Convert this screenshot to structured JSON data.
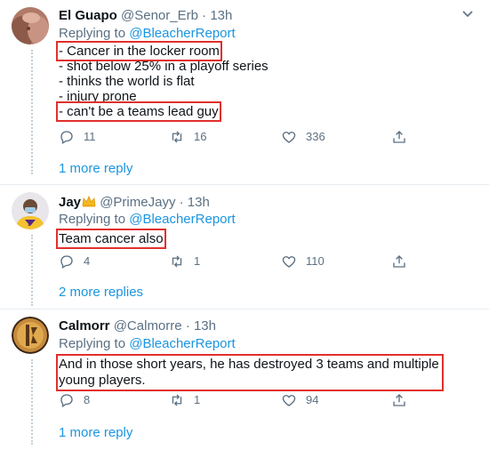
{
  "tweets": [
    {
      "name": "El Guapo",
      "handle": "@Senor_Erb",
      "dot": "·",
      "time": "13h",
      "replying_prefix": "Replying to ",
      "replying_mention": "@BleacherReport",
      "lines": [
        "- Cancer in the locker room",
        "- shot below 25% in a playoff series",
        "- thinks the world is flat",
        "- injury prone",
        "- can't be a teams lead guy"
      ],
      "replies": "11",
      "retweets": "16",
      "likes": "336",
      "more_replies": "1 more reply"
    },
    {
      "name": "Jay",
      "name_emoji": "crown-icon",
      "handle": "@PrimeJayy",
      "dot": "·",
      "time": "13h",
      "replying_prefix": "Replying to ",
      "replying_mention": "@BleacherReport",
      "lines": [
        "Team cancer also"
      ],
      "replies": "4",
      "retweets": "1",
      "likes": "110",
      "more_replies": "2 more replies"
    },
    {
      "name": "Calmorr",
      "handle": "@Calmorre",
      "dot": "·",
      "time": "13h",
      "replying_prefix": "Replying to ",
      "replying_mention": "@BleacherReport",
      "lines": [
        "And in those short years, he has destroyed 3 teams and multiple",
        "young players."
      ],
      "replies": "8",
      "retweets": "1",
      "likes": "94",
      "more_replies": "1 more reply"
    }
  ],
  "colors": {
    "link": "#1b95e0",
    "muted": "#5b7083",
    "highlight_box": "#e0302c",
    "separator": "#e6ecf0"
  }
}
